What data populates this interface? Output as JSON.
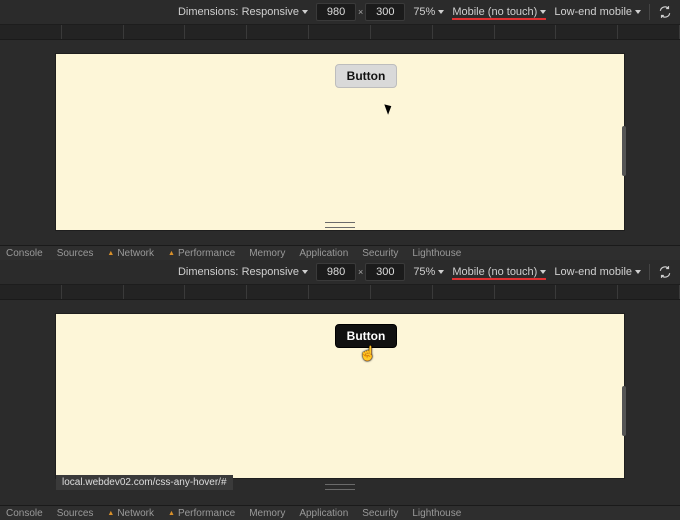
{
  "toolbar": {
    "dimensions_label": "Dimensions:",
    "dimensions_value": "Responsive",
    "width": "980",
    "height": "300",
    "size_sep": "×",
    "zoom": "75%",
    "device": "Mobile (no touch)",
    "throttle": "Low-end mobile"
  },
  "button": {
    "label_normal": "Button",
    "label_hover": "Button"
  },
  "url_tooltip": "local.webdev02.com/css-any-hover/#",
  "tabs": {
    "console": "Console",
    "sources": "Sources",
    "network": "Network",
    "performance": "Performance",
    "memory": "Memory",
    "application": "Application",
    "security": "Security",
    "lighthouse": "Lighthouse"
  },
  "cursor_hand_glyph": "☝"
}
